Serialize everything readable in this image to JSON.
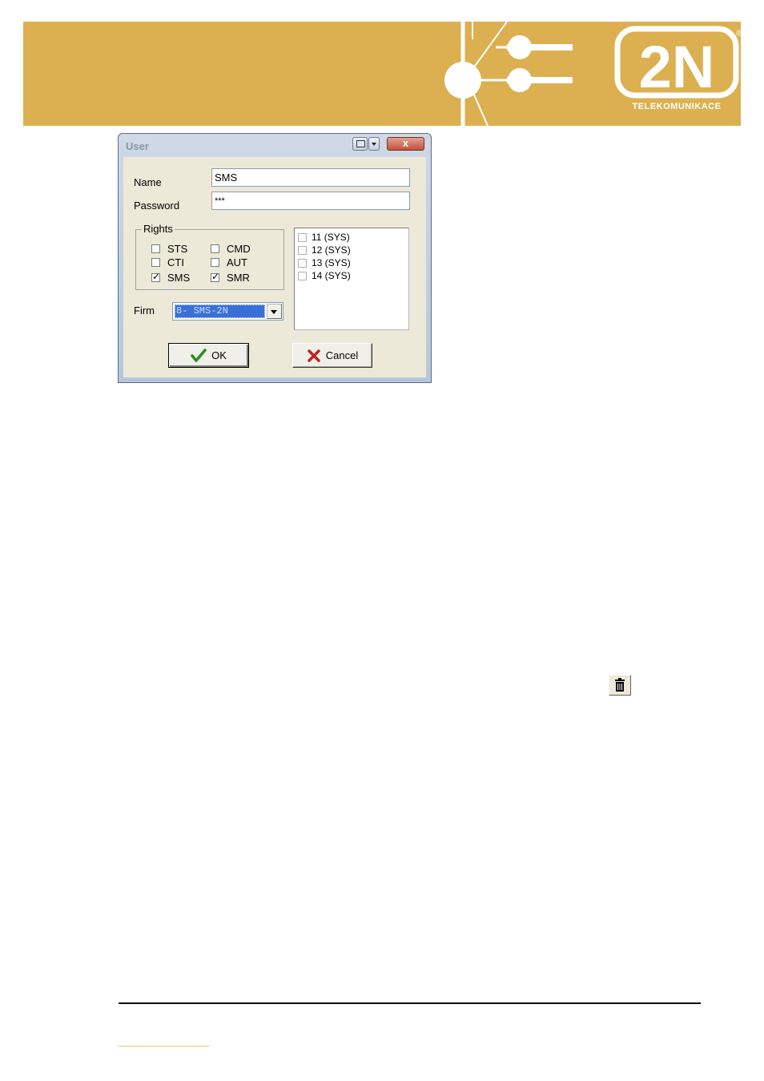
{
  "colors": {
    "banner": "#dcb050",
    "window_frame": "#b6c6da",
    "dialog_face": "#ece9d8",
    "selection": "#3a6fd8",
    "ok_check": "#2e8b1e",
    "cancel_x": "#c0241a"
  },
  "header": {
    "logo_text": "2N",
    "logo_subtitle": "TELEKOMUNIKACE",
    "registered_mark": "®"
  },
  "dialog": {
    "title": "User",
    "fields": {
      "name_label": "Name",
      "name_value": "SMS",
      "password_label": "Password",
      "password_value": "***"
    },
    "rights": {
      "group_label": "Rights",
      "items": [
        {
          "label": "STS",
          "checked": false
        },
        {
          "label": "CMD",
          "checked": false
        },
        {
          "label": "CTI",
          "checked": false
        },
        {
          "label": "AUT",
          "checked": false
        },
        {
          "label": "SMS",
          "checked": true
        },
        {
          "label": "SMR",
          "checked": true
        }
      ]
    },
    "list_items": [
      {
        "label": "11 (SYS)",
        "checked": false
      },
      {
        "label": "12 (SYS)",
        "checked": false
      },
      {
        "label": "13 (SYS)",
        "checked": false
      },
      {
        "label": "14 (SYS)",
        "checked": false
      }
    ],
    "firm": {
      "label": "Firm",
      "selected": "8- SMS-2N"
    },
    "buttons": {
      "ok_label": "OK",
      "cancel_label": "Cancel"
    }
  },
  "toolbar_icon": "trash-icon"
}
